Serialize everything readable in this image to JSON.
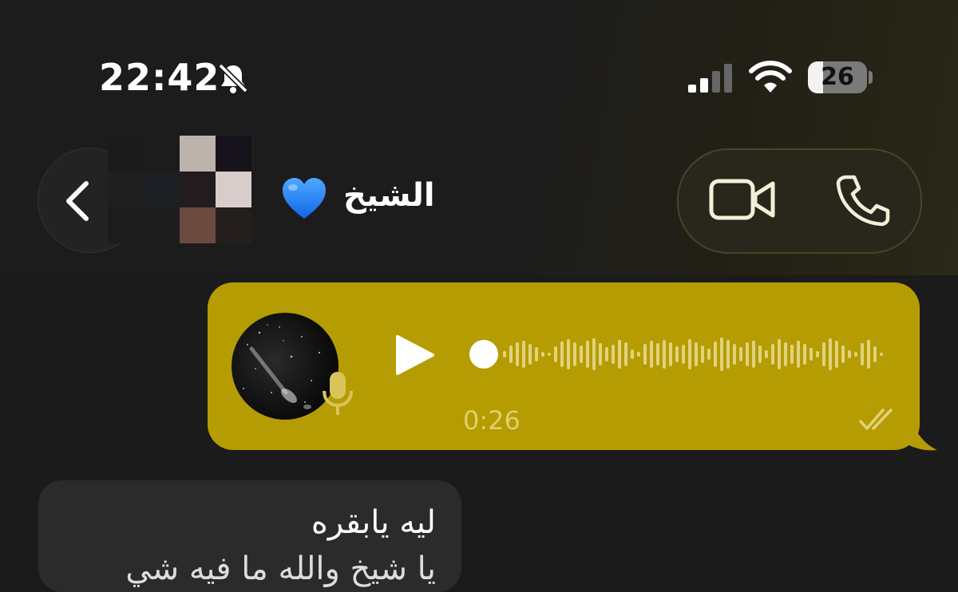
{
  "status_bar": {
    "time": "22:42",
    "silent_icon": "bell-slash-icon",
    "signal_icon": "cellular-signal-icon",
    "wifi_icon": "wifi-icon",
    "battery_level": "26"
  },
  "header": {
    "back_icon": "chevron-left-icon",
    "contact_name": "الشيخ",
    "contact_emoji": "💙",
    "video_call_icon": "video-camera-icon",
    "voice_call_icon": "phone-icon"
  },
  "messages": [
    {
      "direction": "outgoing",
      "type": "voice",
      "duration": "0:26",
      "status_icon": "double-check-icon",
      "play_icon": "play-icon",
      "mic_icon": "microphone-icon",
      "playback_progress": 0
    },
    {
      "direction": "incoming",
      "type": "text",
      "text": "ليه يابقره",
      "text_line2": "يا شيخ والله ما فيه شي"
    }
  ],
  "colors": {
    "outgoing_bubble": "#b59c02",
    "incoming_bubble": "#2b2b2b",
    "background": "#1b1b1b"
  }
}
